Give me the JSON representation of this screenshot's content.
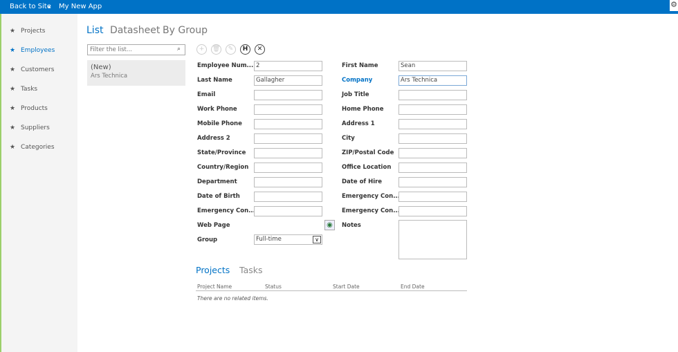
{
  "topbar": {
    "back": "Back to Site",
    "sep": "▸",
    "app": "My New App",
    "gear": "⚙"
  },
  "sidebar": {
    "items": [
      {
        "label": "Projects"
      },
      {
        "label": "Employees",
        "active": true
      },
      {
        "label": "Customers"
      },
      {
        "label": "Tasks"
      },
      {
        "label": "Products"
      },
      {
        "label": "Suppliers"
      },
      {
        "label": "Categories"
      }
    ]
  },
  "view_tabs": [
    {
      "label": "List"
    },
    {
      "label": "Datasheet"
    },
    {
      "label": "By Group"
    }
  ],
  "filter": {
    "placeholder": "Filter the list..."
  },
  "list": [
    {
      "title": "(New)",
      "subtitle": "Ars Technica"
    }
  ],
  "toolbar": [
    "+",
    "🗑",
    "✎",
    "H",
    "✕"
  ],
  "form": {
    "left": [
      {
        "label": "Employee Num...",
        "value": "2"
      },
      {
        "label": "Last Name",
        "value": "Gallagher"
      },
      {
        "label": "Email",
        "value": ""
      },
      {
        "label": "Work Phone",
        "value": ""
      },
      {
        "label": "Mobile Phone",
        "value": ""
      },
      {
        "label": "Address 2",
        "value": ""
      },
      {
        "label": "State/Province",
        "value": ""
      },
      {
        "label": "Country/Region",
        "value": ""
      },
      {
        "label": "Department",
        "value": ""
      },
      {
        "label": "Date of Birth",
        "value": ""
      },
      {
        "label": "Emergency Con...",
        "value": ""
      },
      {
        "label": "Web Page"
      },
      {
        "label": "Group",
        "value": "Full-time"
      }
    ],
    "right": [
      {
        "label": "First Name",
        "value": "Sean"
      },
      {
        "label": "Company",
        "value": "Ars Technica"
      },
      {
        "label": "Job Title",
        "value": ""
      },
      {
        "label": "Home Phone",
        "value": ""
      },
      {
        "label": "Address 1",
        "value": ""
      },
      {
        "label": "City",
        "value": ""
      },
      {
        "label": "ZIP/Postal Code",
        "value": ""
      },
      {
        "label": "Office Location",
        "value": ""
      },
      {
        "label": "Date of Hire",
        "value": ""
      },
      {
        "label": "Emergency Con...",
        "value": ""
      },
      {
        "label": "Emergency Con...",
        "value": ""
      },
      {
        "label": "Notes",
        "value": ""
      }
    ]
  },
  "related": {
    "tabs": [
      {
        "label": "Projects"
      },
      {
        "label": "Tasks"
      }
    ],
    "columns": [
      "Project Name",
      "Status",
      "Start Date",
      "End Date"
    ],
    "empty": "There are no related items."
  }
}
